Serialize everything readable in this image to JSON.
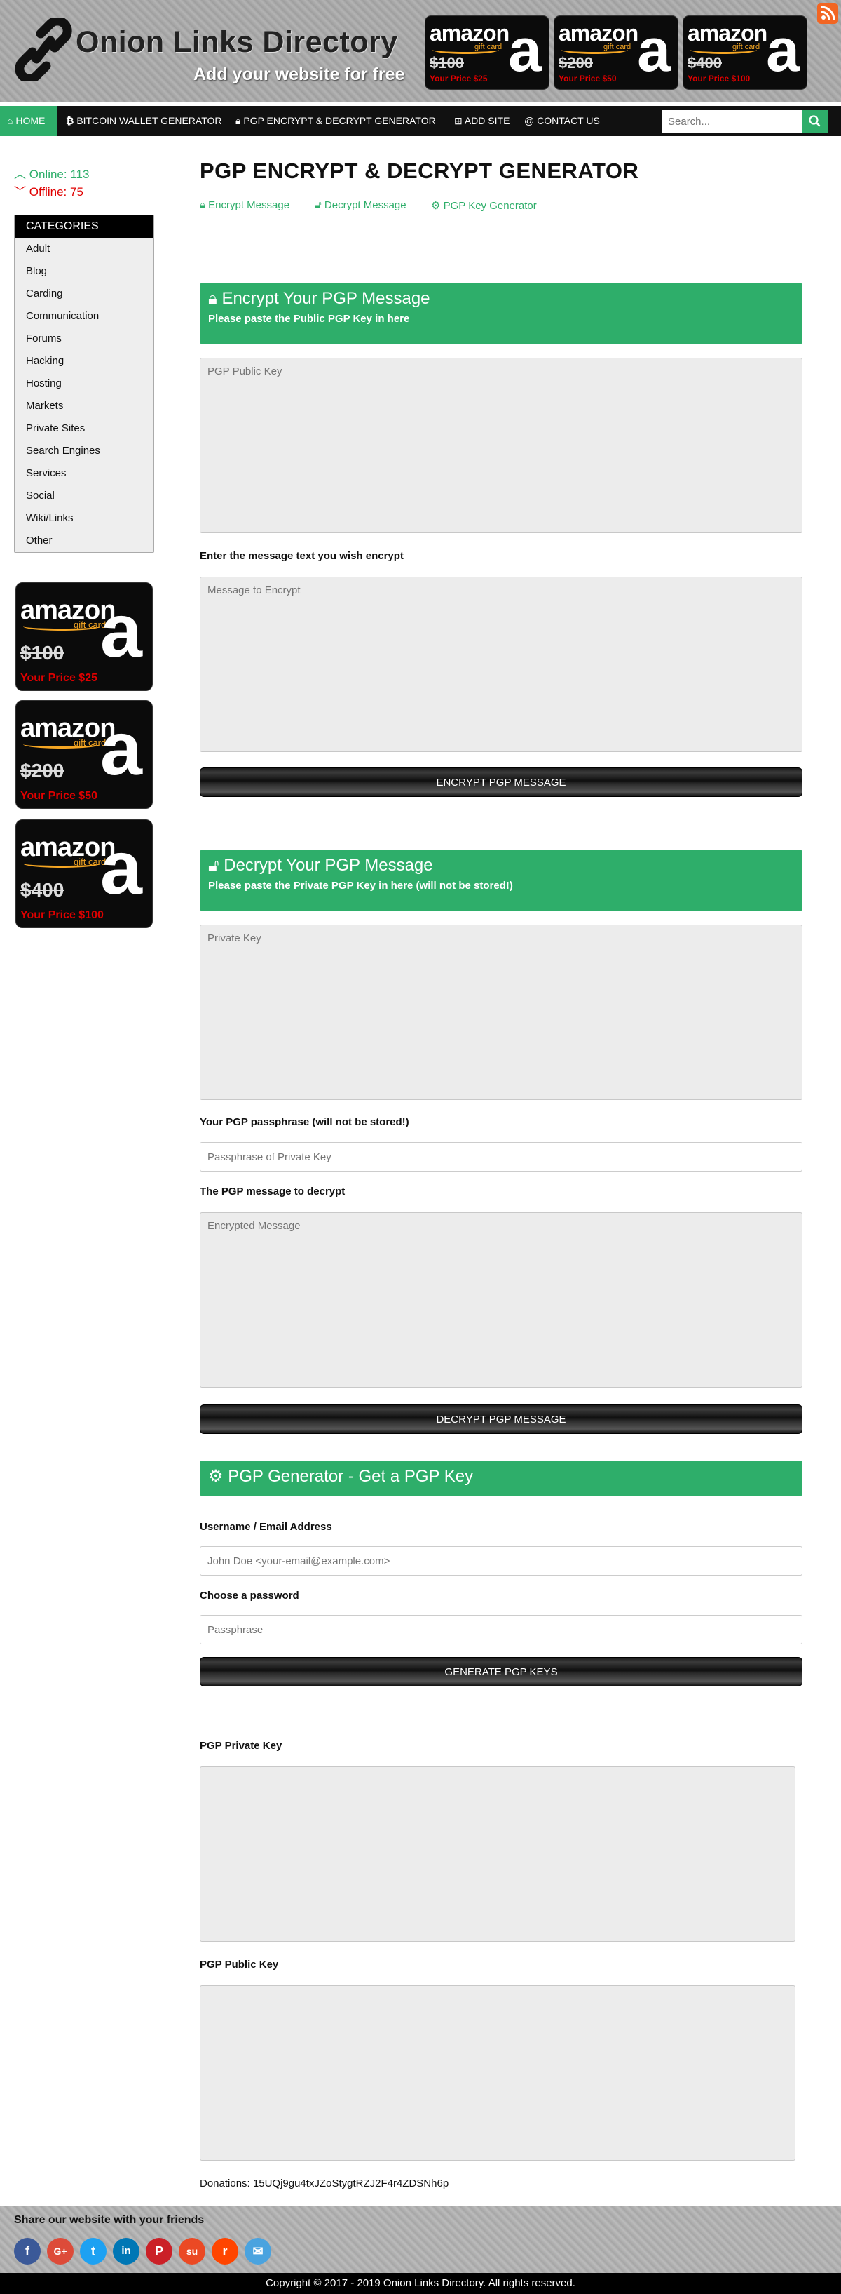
{
  "site": {
    "title": "Onion Links Directory",
    "subtitle": "Add your website for free"
  },
  "gift_cards": [
    {
      "brand": "amazon",
      "tag": "gift card",
      "old_price": "$100",
      "new_price": "Your Price $25"
    },
    {
      "brand": "amazon",
      "tag": "gift card",
      "old_price": "$200",
      "new_price": "Your Price $50"
    },
    {
      "brand": "amazon",
      "tag": "gift card",
      "old_price": "$400",
      "new_price": "Your Price $100"
    }
  ],
  "nav": {
    "home": "HOME",
    "bitcoin": "BITCOIN WALLET GENERATOR",
    "pgp": "PGP ENCRYPT & DECRYPT GENERATOR",
    "add_site": "ADD SITE",
    "contact": "CONTACT US",
    "search_placeholder": "Search..."
  },
  "status": {
    "online": "Online: 113",
    "offline": "Offline: 75"
  },
  "categories": {
    "title": "CATEGORIES",
    "items": [
      "Adult",
      "Blog",
      "Carding",
      "Communication",
      "Forums",
      "Hacking",
      "Hosting",
      "Markets",
      "Private Sites",
      "Search Engines",
      "Services",
      "Social",
      "Wiki/Links",
      "Other"
    ]
  },
  "main": {
    "title": "PGP ENCRYPT & DECRYPT GENERATOR",
    "tabs": [
      "Encrypt Message",
      "Decrypt Message",
      "PGP Key Generator"
    ]
  },
  "encrypt": {
    "title": "Encrypt Your PGP Message",
    "subtitle": "Please paste the Public PGP Key in here",
    "public_key_placeholder": "PGP Public Key",
    "message_label": "Enter the message text you wish encrypt",
    "message_placeholder": "Message to Encrypt",
    "button": "ENCRYPT PGP MESSAGE"
  },
  "decrypt": {
    "title": "Decrypt Your PGP Message",
    "subtitle": "Please paste the Private PGP Key in here (will not be stored!)",
    "private_key_placeholder": "Private Key",
    "passphrase_label": "Your PGP passphrase (will not be stored!)",
    "passphrase_placeholder": "Passphrase of Private Key",
    "message_label": "The PGP message to decrypt",
    "message_placeholder": "Encrypted Message",
    "button": "DECRYPT PGP MESSAGE"
  },
  "generator": {
    "title": "PGP Generator - Get a PGP Key",
    "username_label": "Username / Email Address",
    "username_placeholder": "John Doe <your-email@example.com>",
    "password_label": "Choose a password",
    "password_placeholder": "Passphrase",
    "button": "GENERATE PGP KEYS",
    "private_key_label": "PGP Private Key",
    "public_key_label": "PGP Public Key"
  },
  "donations": "Donations: 15UQj9gu4txJZoStygtRZJ2F4r4ZDSNh6p",
  "footer": {
    "share_text": "Share our website with your friends",
    "social": [
      {
        "icon": "facebook-icon",
        "glyph": "f",
        "color": "#3b5998"
      },
      {
        "icon": "google-plus-icon",
        "glyph": "G+",
        "color": "#dd4b39"
      },
      {
        "icon": "twitter-icon",
        "glyph": "t",
        "color": "#1da1f2"
      },
      {
        "icon": "linkedin-icon",
        "glyph": "in",
        "color": "#0077b5"
      },
      {
        "icon": "pinterest-icon",
        "glyph": "P",
        "color": "#cb2027"
      },
      {
        "icon": "stumbleupon-icon",
        "glyph": "su",
        "color": "#eb4924"
      },
      {
        "icon": "reddit-icon",
        "glyph": "r",
        "color": "#ff4500"
      },
      {
        "icon": "email-icon",
        "glyph": "✉",
        "color": "#4aa3df"
      }
    ],
    "copyright": "Copyright © 2017 - 2019 Onion Links Directory. All rights reserved."
  },
  "colors": {
    "accent": "#2eae6a",
    "offline": "#e00000",
    "nav_bg": "#111111"
  }
}
